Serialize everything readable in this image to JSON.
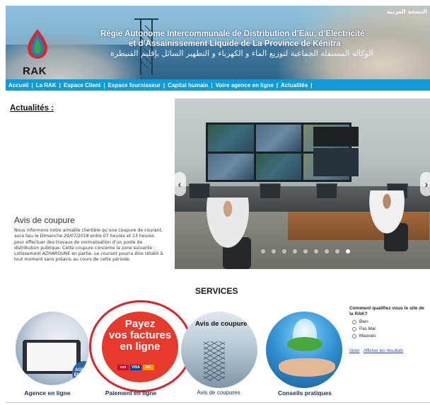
{
  "header": {
    "arabic_link": "النسخة العربية",
    "logo_text": "RAK",
    "title_line1": "Régie Autonome Intercommunale de Distribution d’Eau, d’Electricité",
    "title_line2": "et d’Assainissement  Liquide de La Province  de Kénitra",
    "title_arabic": "الوكالة المستقلة الجماعية لتوزيع الماء و الكهرباء و التطهير السائل بإقليم القنيطرة"
  },
  "nav": {
    "items": [
      {
        "label": "Accueil"
      },
      {
        "label": "La RAK"
      },
      {
        "label": "Espace Client"
      },
      {
        "label": "Espace fournisseur"
      },
      {
        "label": "Capital humain"
      },
      {
        "label": "Votre agence en ligne"
      },
      {
        "label": "Actualités"
      }
    ],
    "separator": "|"
  },
  "news": {
    "section_title": "Actualités :",
    "headline": "Avis de coupure",
    "body": "Nous informons notre aimable clientèle qu’une coupure de courant, aura lieu le Dimanche 29/07/2018 entre 07 heures et 13 heures pour effectuer des travaux de normalisation d’un poste de distribution publique. Cette coupure concerne la zone suivante : Lotissement AZHAROUNE en partie. Le courant pourra être rétabli à tout moment sans préavis au cours de cette période."
  },
  "slider": {
    "prev_glyph": "‹",
    "next_glyph": "›",
    "dot_count": 9,
    "active_dot": 8
  },
  "services": {
    "title": "SERVICES",
    "items": [
      {
        "label": "Agence en ligne",
        "badge": "AGENCE EN LIGNE"
      },
      {
        "label": "Paiement en ligne",
        "promo_line1": "Payez",
        "promo_line2": "vos factures",
        "promo_line3": "en ligne",
        "cards": [
          "cmi",
          "VISA",
          "MC"
        ]
      },
      {
        "label": "Avis de coupures",
        "caption": "Avis de coupure"
      },
      {
        "label": "Conseils pratiques"
      }
    ]
  },
  "poll": {
    "question": "Comment qualifiez vous le site de la RAK?",
    "options": [
      "Bien",
      "Pas Mal",
      "Mauvais"
    ],
    "vote_link": "Voter",
    "results_link": "Afficher les résultats"
  },
  "colors": {
    "nav_bg": "#0f9bd7",
    "services_label": "#1a2f5a",
    "promo_red": "#e53a2c",
    "highlight_circle": "#d8232a"
  }
}
